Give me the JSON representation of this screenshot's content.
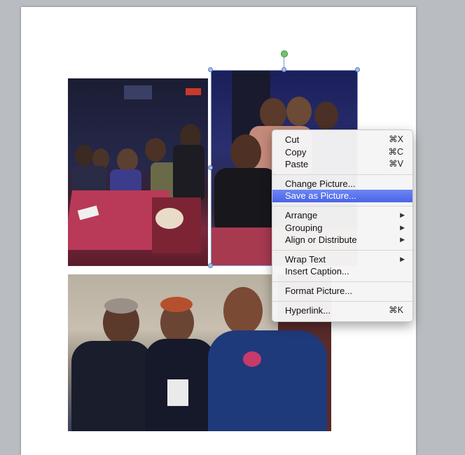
{
  "context_menu": {
    "items": [
      {
        "label": "Cut",
        "shortcut": "⌘X"
      },
      {
        "label": "Copy",
        "shortcut": "⌘C"
      },
      {
        "label": "Paste",
        "shortcut": "⌘V"
      },
      {
        "label": "Change Picture..."
      },
      {
        "label": "Save as Picture...",
        "highlighted": true
      },
      {
        "label": "Arrange",
        "arrow": "▶"
      },
      {
        "label": "Grouping",
        "arrow": "▶"
      },
      {
        "label": "Align or Distribute",
        "arrow": "▶"
      },
      {
        "label": "Wrap Text",
        "arrow": "▶"
      },
      {
        "label": "Insert Caption..."
      },
      {
        "label": "Format Picture..."
      },
      {
        "label": "Hyperlink...",
        "shortcut": "⌘K"
      }
    ]
  },
  "colors": {
    "highlight": "#5872ed",
    "selection": "#7f9bd6",
    "rotate_handle": "#6fc36f"
  }
}
